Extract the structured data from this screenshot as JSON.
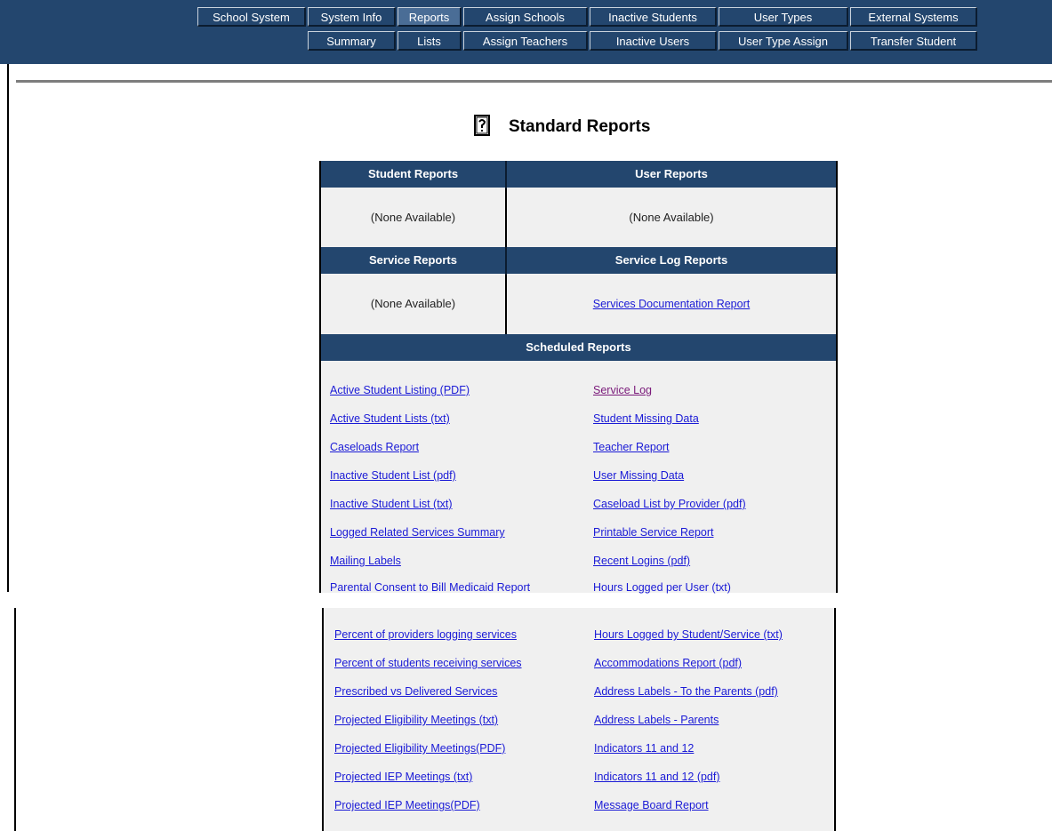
{
  "nav": {
    "row1": [
      "School System",
      "System Info",
      "Reports",
      "Assign Schools",
      "Inactive Students",
      "User Types",
      "External Systems"
    ],
    "row2": [
      "Summary",
      "Lists",
      "Assign Teachers",
      "Inactive Users",
      "User Type Assign",
      "Transfer Student"
    ],
    "active": "Reports"
  },
  "page": {
    "title": "Standard Reports",
    "title_icon": "report-question-icon"
  },
  "sections": {
    "student_reports": {
      "header": "Student Reports",
      "value": "(None Available)"
    },
    "user_reports": {
      "header": "User Reports",
      "value": "(None Available)"
    },
    "service_reports": {
      "header": "Service Reports",
      "value": "(None Available)"
    },
    "service_log_reports": {
      "header": "Service Log Reports",
      "link": "Services Documentation Report"
    },
    "scheduled_reports": {
      "header": "Scheduled Reports"
    }
  },
  "scheduled": {
    "left": [
      "Active Student Listing (PDF)",
      "Active Student Lists (txt)",
      "Caseloads Report",
      "Inactive Student List (pdf)",
      "Inactive Student List (txt)",
      "Logged Related Services Summary",
      "Mailing Labels",
      "Parental Consent to Bill Medicaid Report"
    ],
    "right": [
      "Service Log",
      "Student Missing Data",
      "Teacher Report",
      "User Missing Data",
      "Caseload List by Provider (pdf)",
      "Printable Service Report",
      "Recent Logins (pdf)",
      "Hours Logged per User (txt)"
    ],
    "left2": [
      "Percent of providers logging services",
      "Percent of students receiving services",
      "Prescribed vs Delivered Services",
      "Projected Eligibility Meetings (txt)",
      "Projected Eligibility Meetings(PDF)",
      "Projected IEP Meetings (txt)",
      "Projected IEP Meetings(PDF)"
    ],
    "right2": [
      "Hours Logged by Student/Service (txt)",
      "Accommodations Report (pdf)",
      "Address Labels - To the Parents (pdf)",
      "Address Labels - Parents",
      "Indicators 11 and 12",
      "Indicators 11 and 12 (pdf)",
      "Message Board Report"
    ]
  },
  "colors": {
    "nav_bg": "#23466e",
    "header_bg": "#23466e",
    "link": "#1a1ad6",
    "visited_link": "#7a1a7a",
    "panel_bg": "#f0f0f0"
  }
}
